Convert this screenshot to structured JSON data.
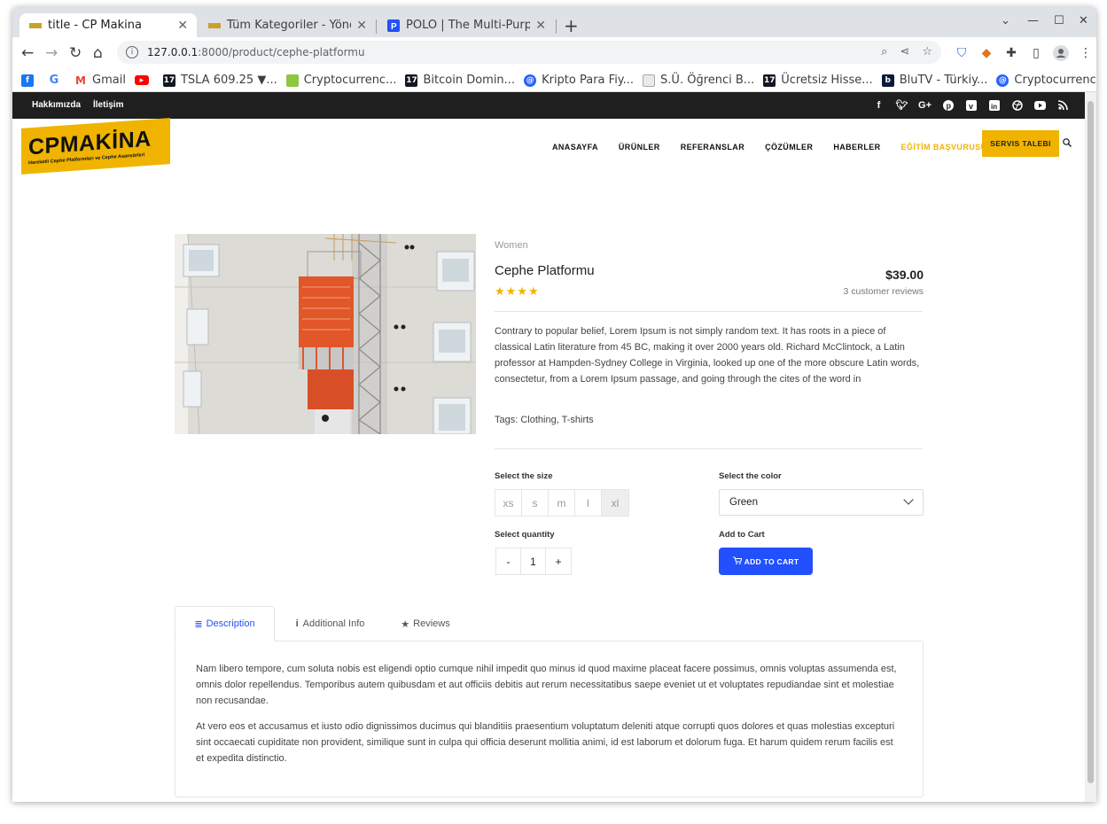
{
  "browser": {
    "tabs": [
      {
        "title": "title - CP Makina"
      },
      {
        "title": "Tüm Kategoriler - Yönetic"
      },
      {
        "title": "POLO | The Multi-Purpose"
      }
    ],
    "url_host": "127.0.0.1",
    "url_rest": ":8000/product/cephe-platformu",
    "bookmarks": [
      "Gmail",
      "TSLA 609.25 ▼...",
      "Cryptocurrenc...",
      "Bitcoin Domin...",
      "Kripto Para Fiy...",
      "S.Ü. Öğrenci B...",
      "Ücretsiz Hisse...",
      "BluTV - Türkiy...",
      "Cryptocurrenc..."
    ]
  },
  "site": {
    "top_links": [
      "Hakkımızda",
      "İletişim"
    ],
    "social_icons": [
      "facebook-icon",
      "twitter-icon",
      "google-plus-icon",
      "pinterest-icon",
      "vimeo-icon",
      "linkedin-icon",
      "dribbble-icon",
      "youtube-icon",
      "rss-icon"
    ],
    "logo_text": "CPMAKİNA",
    "logo_sub": "Hareketli Cephe Platformları ve Cephe Asansörleri",
    "nav": [
      "ANASAYFA",
      "ÜRÜNLER",
      "REFERANSLAR",
      "ÇÖZÜMLER",
      "HABERLER",
      "EĞİTİM BAŞVURUSU"
    ],
    "cta": "SERVIS TALEBI",
    "accent": "#f0b400"
  },
  "product": {
    "category": "Women",
    "title": "Cephe Platformu",
    "stars": "★★★★",
    "price": "$39.00",
    "reviews": "3 customer reviews",
    "description": "Contrary to popular belief, Lorem Ipsum is not simply random text. It has roots in a piece of classical Latin literature from 45 BC, making it over 2000 years old. Richard McClintock, a Latin professor at Hampden-Sydney College in Virginia, looked up one of the more obscure Latin words, consectetur, from a Lorem Ipsum passage, and going through the cites of the word in",
    "tags": "Tags: Clothing, T-shirts",
    "size_label": "Select the size",
    "sizes": [
      "xs",
      "s",
      "m",
      "l",
      "xl"
    ],
    "color_label": "Select the color",
    "color_value": "Green",
    "quantity_label": "Select quantity",
    "quantity_minus": "-",
    "quantity_value": "1",
    "quantity_plus": "+",
    "cart_label": "Add to Cart",
    "cart_button": "ADD TO CART",
    "button_color": "#2250fc"
  },
  "tabs": {
    "items": [
      "Description",
      "Additional Info",
      "Reviews"
    ],
    "active": "Description",
    "paragraphs": [
      "Nam libero tempore, cum soluta nobis est eligendi optio cumque nihil impedit quo minus id quod maxime placeat facere possimus, omnis voluptas assumenda est, omnis dolor repellendus. Temporibus autem quibusdam et aut officiis debitis aut rerum necessitatibus saepe eveniet ut et voluptates repudiandae sint et molestiae non recusandae.",
      "At vero eos et accusamus et iusto odio dignissimos ducimus qui blanditiis praesentium voluptatum deleniti atque corrupti quos dolores et quas molestias excepturi sint occaecati cupiditate non provident, similique sunt in culpa qui officia deserunt mollitia animi, id est laborum et dolorum fuga. Et harum quidem rerum facilis est et expedita distinctio."
    ]
  }
}
